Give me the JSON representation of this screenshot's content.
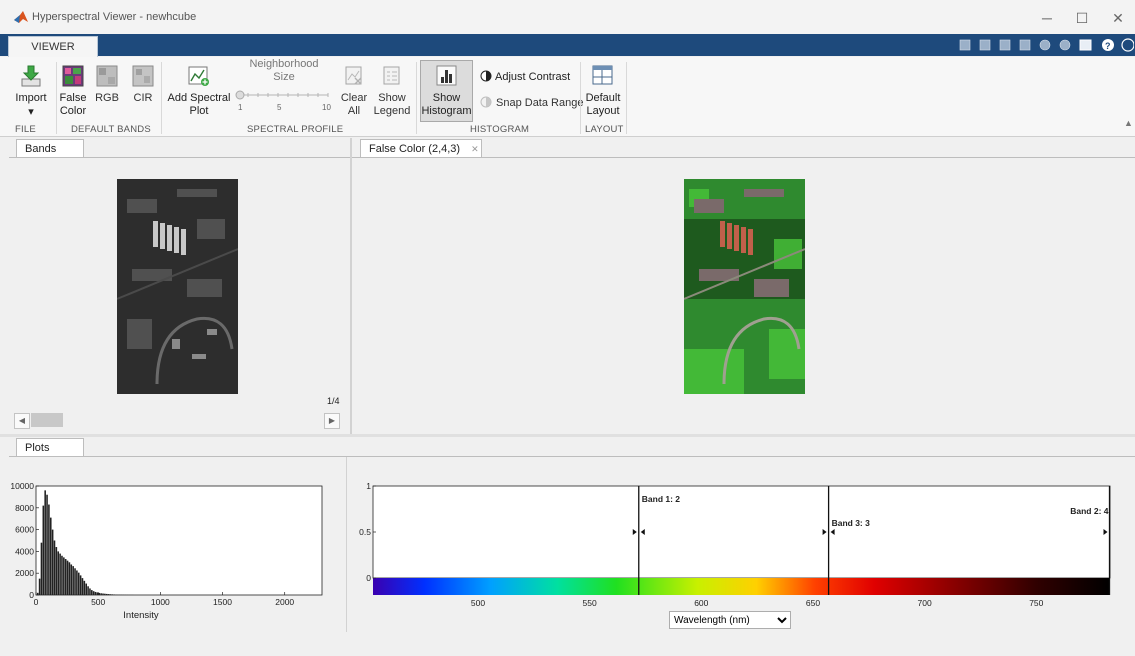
{
  "window": {
    "title": "Hyperspectral Viewer - newhcube",
    "minimize_glyph": "─",
    "maximize_glyph": "☐",
    "close_glyph": "✕"
  },
  "ribbon": {
    "tab_label": "VIEWER",
    "groups": {
      "file": "FILE",
      "default_bands": "DEFAULT BANDS",
      "spectral_profile": "SPECTRAL PROFILE",
      "histogram": "HISTOGRAM",
      "layout": "LAYOUT"
    },
    "buttons": {
      "import": "Import",
      "import_arrow": "▾",
      "false_color": "False\nColor",
      "rgb": "RGB",
      "cir": "CIR",
      "add_spectral_plot": "Add Spectral\nPlot",
      "neighborhood_size": "Neighborhood\nSize",
      "clear_all": "Clear\nAll",
      "show_legend": "Show\nLegend",
      "show_histogram": "Show\nHistogram",
      "adjust_contrast": "Adjust Contrast",
      "snap_data_range": "Snap Data Range",
      "default_layout": "Default\nLayout"
    },
    "slider": {
      "ticks": [
        "1",
        "5",
        "10"
      ],
      "value": 1
    },
    "collapse_glyph": "▲"
  },
  "bands_panel": {
    "tab_label": "Bands",
    "band_counter": "1/4",
    "scroll_left": "◀",
    "scroll_right": "▶"
  },
  "false_color_panel": {
    "tab_label": "False Color (2,4,3)",
    "close_glyph": "✕"
  },
  "plots_panel": {
    "tab_label": "Plots",
    "histogram": {
      "xlabel": "Intensity",
      "x_ticks": [
        "0",
        "500",
        "1000",
        "1500",
        "2000"
      ],
      "y_ticks": [
        "0",
        "2000",
        "4000",
        "6000",
        "8000",
        "10000"
      ]
    },
    "spectrum": {
      "y_ticks": [
        "0",
        "0.5",
        "1"
      ],
      "x_ticks": [
        "500",
        "550",
        "600",
        "650",
        "700",
        "750"
      ],
      "markers": [
        {
          "label": "Band 1: 2"
        },
        {
          "label": "Band 3: 3"
        },
        {
          "label": "Band 2: 4"
        }
      ],
      "unit_select": "Wavelength (nm)"
    }
  },
  "chart_data": [
    {
      "type": "bar",
      "xlabel": "Intensity",
      "ylabel": "",
      "xlim": [
        0,
        2300
      ],
      "ylim": [
        0,
        10000
      ],
      "bin_width": 15,
      "x": [
        15,
        30,
        45,
        60,
        75,
        90,
        105,
        120,
        135,
        150,
        165,
        180,
        195,
        210,
        225,
        240,
        255,
        270,
        285,
        300,
        315,
        330,
        345,
        360,
        375,
        390,
        405,
        420,
        435,
        450,
        465,
        480,
        495,
        510,
        525,
        540,
        555,
        570,
        585,
        600,
        615,
        630,
        645,
        660,
        675,
        690,
        705,
        720,
        735,
        750,
        765,
        780
      ],
      "values": [
        200,
        1500,
        4800,
        8200,
        9600,
        9200,
        8300,
        7100,
        6000,
        5000,
        4400,
        4000,
        3800,
        3600,
        3450,
        3300,
        3150,
        3000,
        2800,
        2650,
        2450,
        2250,
        2050,
        1800,
        1550,
        1300,
        1050,
        800,
        600,
        450,
        350,
        280,
        230,
        190,
        160,
        140,
        120,
        100,
        85,
        70,
        60,
        50,
        40,
        35,
        30,
        25,
        20,
        18,
        15,
        12,
        10,
        8
      ]
    },
    {
      "type": "line",
      "xlabel": "Wavelength (nm)",
      "ylabel": "",
      "xlim": [
        453,
        783
      ],
      "ylim": [
        0,
        1
      ],
      "band_markers": [
        {
          "label": "Band 1: 2",
          "x": 572
        },
        {
          "label": "Band 3: 3",
          "x": 657
        },
        {
          "label": "Band 2: 4",
          "x": 783
        }
      ]
    }
  ],
  "colors": {
    "tab_strip": "#1e4a7c",
    "matlab_logo": "#d9531e",
    "histogram_bars": "#222222"
  }
}
